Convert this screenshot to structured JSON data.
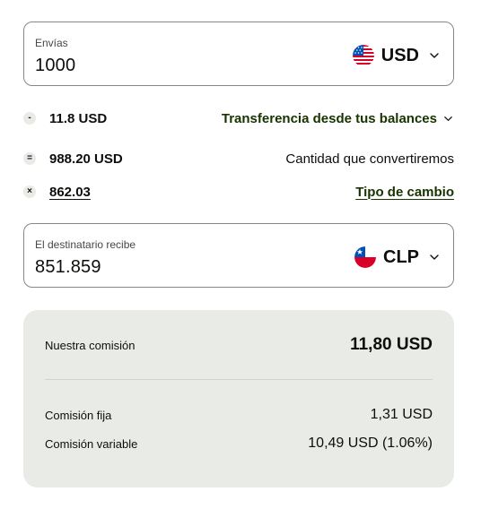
{
  "send": {
    "label": "Envías",
    "amount": "1000",
    "currency": "USD",
    "flag_icon": "us-flag-icon"
  },
  "fees": {
    "fee": {
      "symbol": "-",
      "value": "11.8 USD",
      "right_label": "Transferencia desde tus balances"
    },
    "convert": {
      "symbol": "=",
      "value": "988.20 USD",
      "right_label": "Cantidad que convertiremos"
    },
    "rate": {
      "symbol": "×",
      "value": "862.03",
      "right_label": "Tipo de cambio"
    }
  },
  "receive": {
    "label": "El destinatario recibe",
    "amount": "851.859",
    "currency": "CLP",
    "flag_icon": "chile-flag-icon"
  },
  "fee_breakdown": {
    "our_fee_label": "Nuestra comisión",
    "our_fee_value": "11,80 USD",
    "fixed_label": "Comisión fija",
    "fixed_value": "1,31 USD",
    "variable_label": "Comisión variable",
    "variable_value": "10,49 USD (1.06%)"
  },
  "colors": {
    "accent_text": "#163300",
    "panel_bg": "#e8ebe6",
    "border": "#868685"
  }
}
